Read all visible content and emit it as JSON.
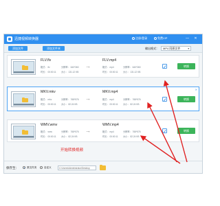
{
  "app": {
    "title": "迅捷视频转换器",
    "links": [
      "注册/登录",
      "免费VIP"
    ],
    "window_controls": [
      "—",
      "✕"
    ]
  },
  "toolbar": {
    "add_file": "添加文件",
    "add_folder": "添加文件夹",
    "output_format_label": "输出格式：",
    "output_format_value": "MP4 同原文件"
  },
  "files": [
    {
      "src_name": "FLV.flv",
      "src_meta": [
        "格式： flv",
        "分辨率： 640*360",
        "时长： 00:00:11",
        "大小： 131.12 KB"
      ],
      "dst_name": "FLV.mp4",
      "dst_meta": [
        "格式： mp4",
        "分辨率： 640*360",
        "时长： 00:00:11",
        "大小： 131.12 KB"
      ],
      "convert_label": "转换"
    },
    {
      "src_name": "MKV.mkv",
      "src_meta": [
        "格式： mkv",
        "分辨率： 768*576",
        "时长： 00:00:11",
        "大小： 82.24 KB"
      ],
      "dst_name": "MKV.mp4",
      "dst_meta": [
        "格式： mp4",
        "分辨率： 768*576",
        "时长： 00:00:11",
        "大小： 82.24 KB"
      ],
      "convert_label": "转换"
    },
    {
      "src_name": "WMV.wmv",
      "src_meta": [
        "格式： wmv",
        "分辨率： 768*576",
        "时长： 00:00:11",
        "大小： 82.24 KB"
      ],
      "dst_name": "WMV.mp4",
      "dst_meta": [
        "格式： mp4",
        "分辨率： 768*576",
        "时长： 00:00:11",
        "大小： 82.24 KB"
      ],
      "convert_label": "转换"
    }
  ],
  "save": {
    "label": "保存至：",
    "option_source": "原文件夹",
    "option_custom": "自定义",
    "path": "C:\\Users\\Administrator\\Desktop"
  },
  "annotation": {
    "text": "开始转换视频",
    "color": "#e02222"
  },
  "colors": {
    "accent": "#2f8ff0",
    "convert_button": "#3cb45a"
  }
}
